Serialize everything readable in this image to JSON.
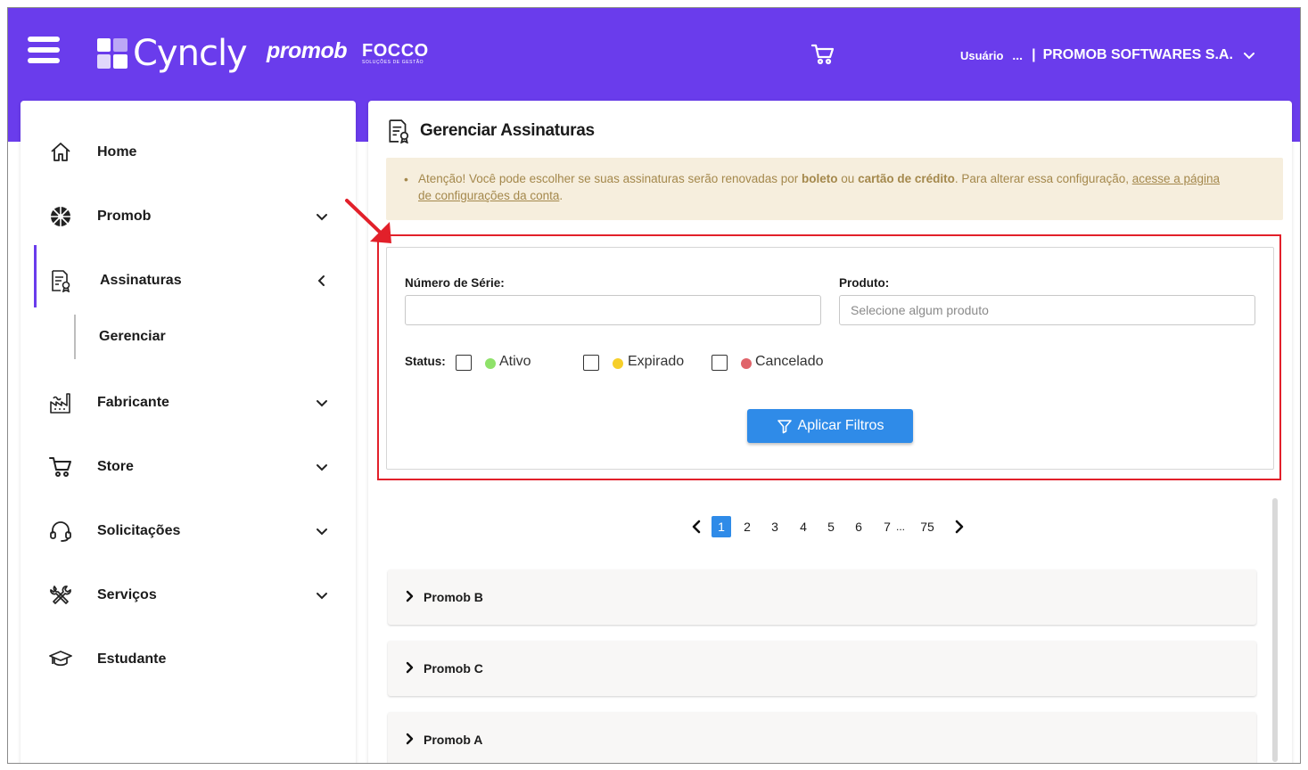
{
  "header": {
    "brand_cyncly": "Cyncly",
    "brand_promob": "promob",
    "brand_focco": "FOCCO",
    "brand_focco_sub": "SOLUÇÕES DE GESTÃO",
    "user_label": "Usuário",
    "user_dots": "...",
    "separator": "|",
    "company": "PROMOB SOFTWARES S.A."
  },
  "sidebar": {
    "items": [
      {
        "label": "Home",
        "icon": "home-icon"
      },
      {
        "label": "Promob",
        "icon": "promob-icon"
      },
      {
        "label": "Assinaturas",
        "icon": "subscription-icon"
      },
      {
        "label": "Fabricante",
        "icon": "factory-icon"
      },
      {
        "label": "Store",
        "icon": "cart-icon"
      },
      {
        "label": "Solicitações",
        "icon": "headset-icon"
      },
      {
        "label": "Serviços",
        "icon": "tools-icon"
      },
      {
        "label": "Estudante",
        "icon": "graduation-cap-icon"
      }
    ],
    "sub_item": "Gerenciar"
  },
  "main": {
    "title": "Gerenciar Assinaturas",
    "alert": {
      "bullet": "•",
      "text_1": "Atenção! Você pode escolher se suas assinaturas serão renovadas por ",
      "bold_1": "boleto",
      "text_2": " ou ",
      "bold_2": "cartão de crédito",
      "text_3": ". Para alterar essa configuração, ",
      "link_1": "acesse a página",
      "link_2": "de configurações da conta",
      "text_4": "."
    },
    "filters": {
      "serial_label": "Número de Série:",
      "serial_value": "",
      "product_label": "Produto:",
      "product_placeholder": "Selecione algum produto",
      "status_label": "Status:",
      "status_options": [
        {
          "label": "Ativo",
          "color": "#8fe26a",
          "checked": false
        },
        {
          "label": "Expirado",
          "color": "#f6cf2a",
          "checked": false
        },
        {
          "label": "Cancelado",
          "color": "#e0646a",
          "checked": false
        }
      ],
      "apply_label": "Aplicar Filtros"
    },
    "pagination": {
      "current": "1",
      "pages": [
        "1",
        "2",
        "3",
        "4",
        "5",
        "6",
        "7"
      ],
      "ellipsis": "...",
      "last": "75"
    },
    "products": [
      "Promob B",
      "Promob C",
      "Promob A"
    ]
  },
  "colors": {
    "brand_purple": "#6a3cec",
    "primary_blue": "#2f8be8",
    "alert_bg": "#f6eedd",
    "alert_text": "#a4884c",
    "highlight_red": "#e2202a"
  }
}
